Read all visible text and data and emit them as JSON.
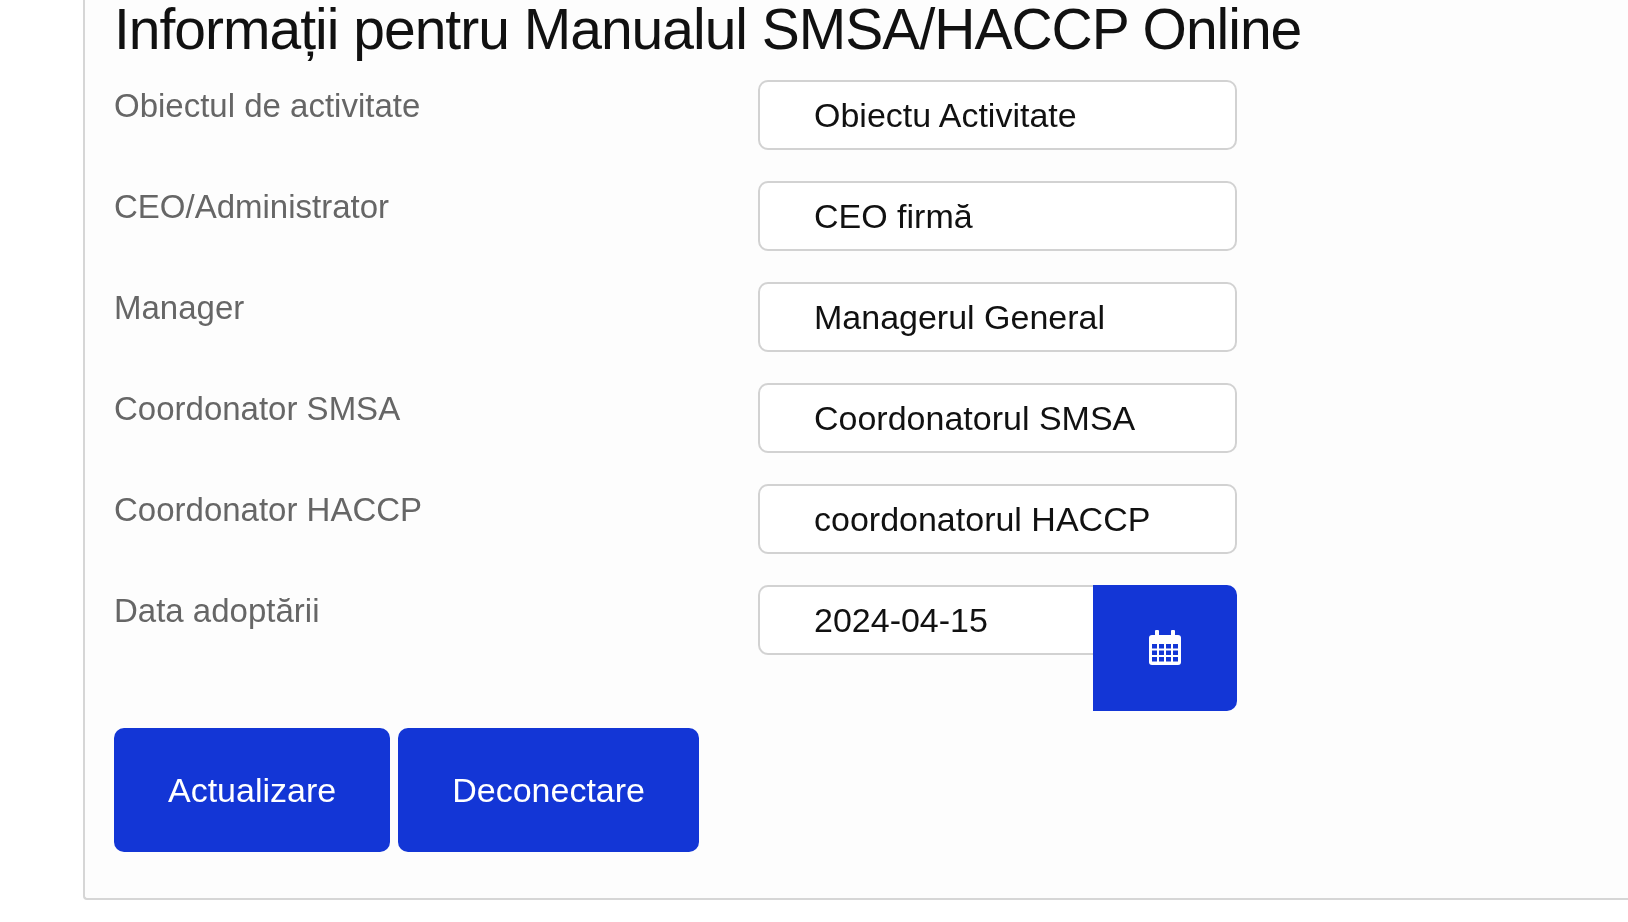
{
  "title": "Informații pentru Manualul SMSA/HACCP Online",
  "fields": [
    {
      "label": "Obiectul de activitate",
      "value": "Obiectu Activitate",
      "kind": "text"
    },
    {
      "label": "CEO/Administrator",
      "value": "CEO firmă",
      "kind": "text"
    },
    {
      "label": "Manager",
      "value": "Managerul General",
      "kind": "text"
    },
    {
      "label": "Coordonator SMSA",
      "value": "Coordonatorul SMSA",
      "kind": "text"
    },
    {
      "label": "Coordonator HACCP",
      "value": "coordonatorul HACCP",
      "kind": "text"
    },
    {
      "label": "Data adoptării",
      "value": "2024-04-15",
      "kind": "date"
    }
  ],
  "buttons": [
    "Actualizare",
    "Deconectare"
  ]
}
